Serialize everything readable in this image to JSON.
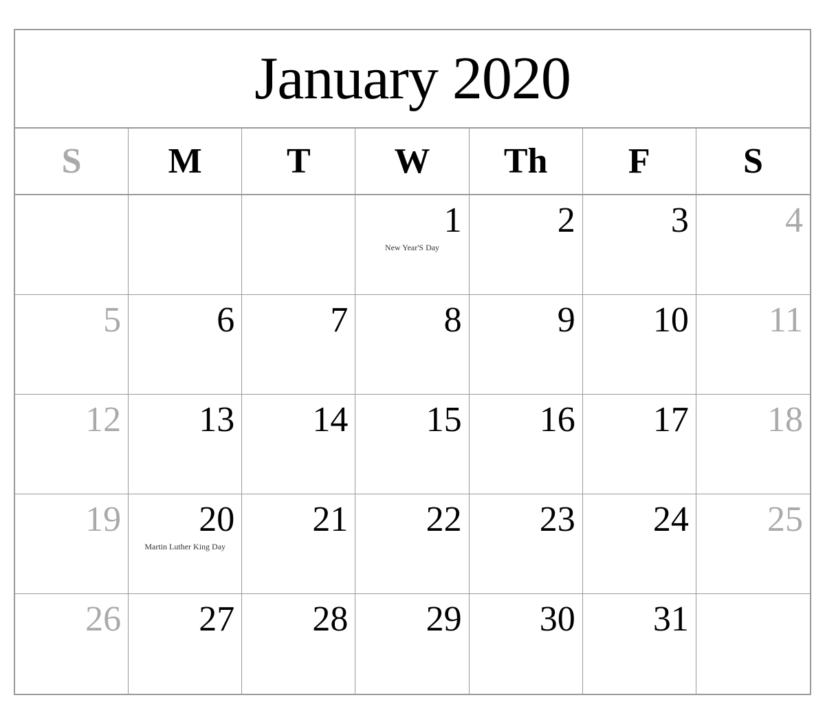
{
  "calendar": {
    "title": "January 2020",
    "headers": [
      "S",
      "M",
      "T",
      "W",
      "Th",
      "F",
      "S"
    ],
    "weeks": [
      [
        {
          "day": "",
          "type": "empty"
        },
        {
          "day": "",
          "type": "empty"
        },
        {
          "day": "",
          "type": "empty"
        },
        {
          "day": "1",
          "type": "normal",
          "holiday": "New Year'S Day"
        },
        {
          "day": "2",
          "type": "normal"
        },
        {
          "day": "3",
          "type": "normal"
        },
        {
          "day": "4",
          "type": "saturday"
        }
      ],
      [
        {
          "day": "5",
          "type": "sunday"
        },
        {
          "day": "6",
          "type": "normal"
        },
        {
          "day": "7",
          "type": "normal"
        },
        {
          "day": "8",
          "type": "normal"
        },
        {
          "day": "9",
          "type": "normal"
        },
        {
          "day": "10",
          "type": "normal"
        },
        {
          "day": "11",
          "type": "saturday"
        }
      ],
      [
        {
          "day": "12",
          "type": "sunday"
        },
        {
          "day": "13",
          "type": "normal"
        },
        {
          "day": "14",
          "type": "normal"
        },
        {
          "day": "15",
          "type": "normal"
        },
        {
          "day": "16",
          "type": "normal"
        },
        {
          "day": "17",
          "type": "normal"
        },
        {
          "day": "18",
          "type": "saturday"
        }
      ],
      [
        {
          "day": "19",
          "type": "sunday"
        },
        {
          "day": "20",
          "type": "normal",
          "holiday": "Martin Luther King Day"
        },
        {
          "day": "21",
          "type": "normal"
        },
        {
          "day": "22",
          "type": "normal"
        },
        {
          "day": "23",
          "type": "normal"
        },
        {
          "day": "24",
          "type": "normal"
        },
        {
          "day": "25",
          "type": "saturday"
        }
      ],
      [
        {
          "day": "26",
          "type": "sunday"
        },
        {
          "day": "27",
          "type": "normal"
        },
        {
          "day": "28",
          "type": "normal"
        },
        {
          "day": "29",
          "type": "normal"
        },
        {
          "day": "30",
          "type": "normal"
        },
        {
          "day": "31",
          "type": "normal"
        },
        {
          "day": "",
          "type": "empty"
        }
      ]
    ]
  }
}
